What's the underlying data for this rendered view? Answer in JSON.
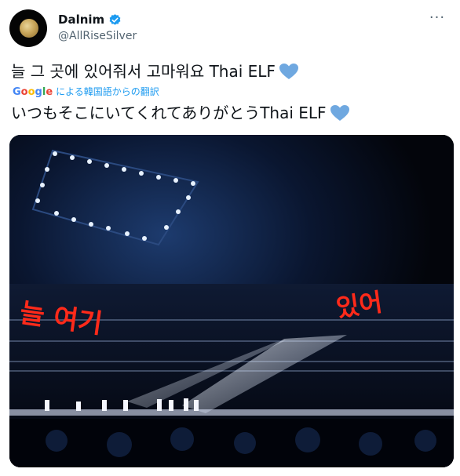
{
  "author": {
    "display_name": "Dalnim",
    "handle": "@AllRiseSilver",
    "verified": true,
    "avatar_icon": "moon-avatar"
  },
  "tweet": {
    "text": "늘 그 곳에 있어줘서 고마워요 Thai ELF",
    "translated_by_prefix": "Google",
    "translated_by_suffix": "による韓国語からの翻訳",
    "translation": "いつもそこにいてくれてありがとうThai ELF",
    "heart_color": "#6fa8e0"
  },
  "media": {
    "description_icon": "concert-photo",
    "banner_text_left": "늘 여기",
    "banner_text_right": "있어",
    "banner_color": "#ff2a1a"
  },
  "colors": {
    "accent": "#1d9bf0",
    "text": "#0f1419",
    "secondary": "#536471"
  }
}
